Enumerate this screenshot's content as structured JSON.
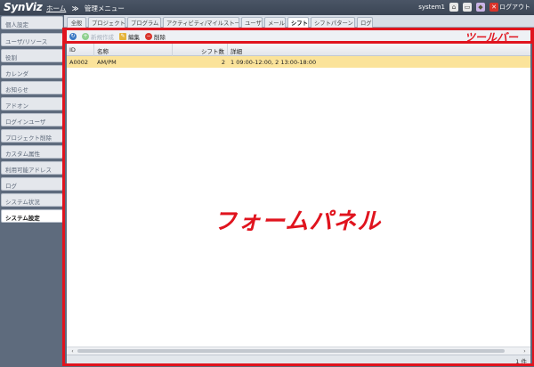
{
  "app": {
    "logo": "SynViz",
    "breadcrumb_home": "ホーム",
    "breadcrumb_sep": "≫",
    "breadcrumb_current": "管理メニュー",
    "user": "system1",
    "logout_label": "ログアウト"
  },
  "sidebar": {
    "items": [
      {
        "label": "個人設定"
      },
      {
        "label": "ユーザ/リソース"
      },
      {
        "label": "役割"
      },
      {
        "label": "カレンダ"
      },
      {
        "label": "お知らせ"
      },
      {
        "label": "アドオン"
      },
      {
        "label": "ログインユーザ"
      },
      {
        "label": "プロジェクト削除"
      },
      {
        "label": "カスタム属性"
      },
      {
        "label": "利用可能アドレス"
      },
      {
        "label": "ログ"
      },
      {
        "label": "システム状況"
      },
      {
        "label": "システム設定"
      }
    ]
  },
  "tabs": [
    {
      "label": "全般"
    },
    {
      "label": "プロジェクト"
    },
    {
      "label": "プログラム"
    },
    {
      "label": "アクティビティ/マイルストーン"
    },
    {
      "label": "ユーザ"
    },
    {
      "label": "メール"
    },
    {
      "label": "シフト"
    },
    {
      "label": "シフトパターン"
    },
    {
      "label": "ログ"
    }
  ],
  "toolbar": {
    "add_label": "新規作成",
    "edit_label": "編集",
    "delete_label": "削除"
  },
  "grid": {
    "columns": [
      "ID",
      "名称",
      "シフト数",
      "詳細"
    ],
    "rows": [
      {
        "id": "A0002",
        "name": "AM/PM",
        "count": "2",
        "detail": "1 09:00-12:00, 2 13:00-18:00"
      }
    ]
  },
  "status": {
    "count_label": "1 件"
  },
  "annotations": {
    "toolbar": "ツールバー",
    "form_panel": "フォームパネル"
  },
  "colors": {
    "accent_red": "#e0141e",
    "selected_row": "#fbe39a",
    "chrome": "#5e6b7d"
  }
}
